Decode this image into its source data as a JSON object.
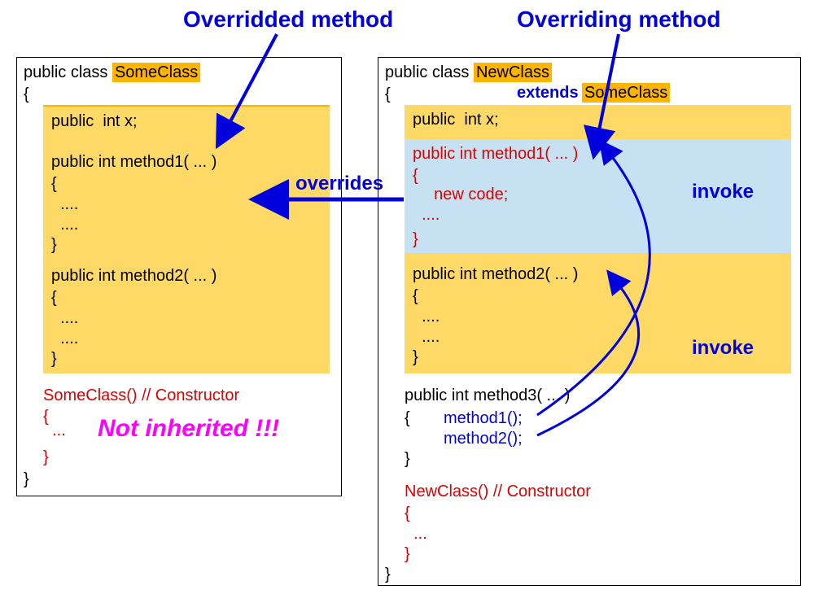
{
  "titles": {
    "overridded": "Overridded method",
    "overriding": "Overriding method"
  },
  "left": {
    "decl1": "public class ",
    "className": "SomeClass",
    "openBrace": "{",
    "field": "public  int x;",
    "m1sig": "public int method1( ... )",
    "m1open": "{",
    "m1body1": "  ....",
    "m1body2": "  ....",
    "m1close": "}",
    "m2sig": "public int method2( ... )",
    "m2open": "{",
    "m2body1": "  ....",
    "m2body2": "  ....",
    "m2close": "}",
    "ctor": "SomeClass() // Constructor",
    "ctorOpen": "{",
    "ctorBody": "  ...",
    "ctorClose": "}",
    "closeBrace": "}",
    "notInherited": "Not inherited !!!"
  },
  "middle": {
    "overrides": "overrides"
  },
  "right": {
    "decl1": "public class ",
    "className": "NewClass",
    "extends": "extends",
    "superName": "SomeClass",
    "openBrace": "{",
    "field": "public  int x;",
    "m1sig": "public int method1( ... )",
    "m1open": "{",
    "m1body1": "  new code;",
    "m1body2": "  ....",
    "m1close": "}",
    "m2sig": "public int method2( ... )",
    "m2open": "{",
    "m2body1": "  ....",
    "m2body2": "  ....",
    "m2close": "}",
    "m3sig": "public int method3( ... )",
    "m3open": "{",
    "m3call1": "method1();",
    "m3call2": "method2();",
    "m3close": "}",
    "ctor": "NewClass() // Constructor",
    "ctorOpen": "{",
    "ctorBody": "  ...",
    "ctorClose": "}",
    "closeBrace": "}",
    "invoke1": "invoke",
    "invoke2": "invoke"
  }
}
